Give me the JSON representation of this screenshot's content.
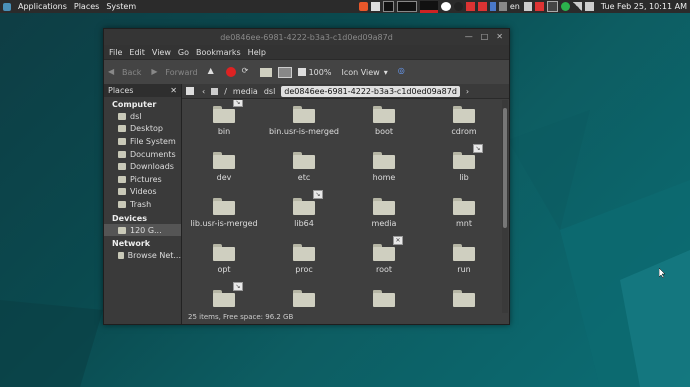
{
  "panel": {
    "menus": [
      "Applications",
      "Places",
      "System"
    ],
    "clock": "Tue Feb 25, 10:11 AM",
    "lang": "en"
  },
  "window": {
    "title": "de0846ee-6981-4222-b3a3-c1d0ed09a87d"
  },
  "menubar": [
    "File",
    "Edit",
    "View",
    "Go",
    "Bookmarks",
    "Help"
  ],
  "toolbar": {
    "back": "Back",
    "forward": "Forward",
    "zoom": "100%",
    "view": "Icon View"
  },
  "sidebar": {
    "header": "Places",
    "computer_title": "Computer",
    "computer": [
      "dsl",
      "Desktop",
      "File System",
      "Documents",
      "Downloads",
      "Pictures",
      "Videos",
      "Trash"
    ],
    "devices_title": "Devices",
    "devices": [
      "120 G..."
    ],
    "network_title": "Network",
    "network": [
      "Browse Net..."
    ]
  },
  "pathbar": [
    "/",
    "media",
    "dsl",
    "de0846ee-6981-4222-b3a3-c1d0ed09a87d"
  ],
  "files": [
    {
      "name": "bin",
      "emblem": "link"
    },
    {
      "name": "bin.usr-is-merged",
      "emblem": ""
    },
    {
      "name": "boot",
      "emblem": ""
    },
    {
      "name": "cdrom",
      "emblem": ""
    },
    {
      "name": "dev",
      "emblem": ""
    },
    {
      "name": "etc",
      "emblem": ""
    },
    {
      "name": "home",
      "emblem": ""
    },
    {
      "name": "lib",
      "emblem": "link"
    },
    {
      "name": "lib.usr-is-merged",
      "emblem": ""
    },
    {
      "name": "lib64",
      "emblem": "link"
    },
    {
      "name": "media",
      "emblem": ""
    },
    {
      "name": "mnt",
      "emblem": ""
    },
    {
      "name": "opt",
      "emblem": ""
    },
    {
      "name": "proc",
      "emblem": ""
    },
    {
      "name": "root",
      "emblem": "x"
    },
    {
      "name": "run",
      "emblem": ""
    },
    {
      "name": "",
      "emblem": "link"
    },
    {
      "name": "",
      "emblem": ""
    },
    {
      "name": "",
      "emblem": ""
    },
    {
      "name": "",
      "emblem": ""
    }
  ],
  "status": "25 items, Free space: 96.2 GB",
  "colors": {
    "accent": "#4a90b8",
    "folder": "#cfcfc0",
    "panel": "#2b2b2b"
  }
}
